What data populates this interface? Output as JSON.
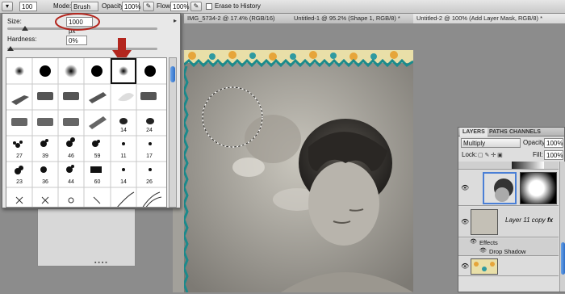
{
  "options_bar": {
    "brush_size": "100",
    "mode_label": "Mode:",
    "mode_value": "Brush",
    "opacity_label": "Opacity:",
    "opacity_value": "100%",
    "flow_label": "Flow:",
    "flow_value": "100%",
    "erase_history_label": "Erase to History"
  },
  "tabs": [
    {
      "label": "IMG_5734-2 @ 17.4% (RGB/16)"
    },
    {
      "label": "Untitled-1 @ 95.2% (Shape 1, RGB/8) *"
    },
    {
      "label": "Untitled-2 @ 100% (Add Layer Mask, RGB/8) *"
    }
  ],
  "brush_panel": {
    "size_label": "Size:",
    "size_value": "1000 px",
    "hardness_label": "Hardness:",
    "hardness_value": "0%",
    "rows": [
      [
        "",
        "",
        "",
        "",
        "",
        ""
      ],
      [
        "",
        "",
        "",
        "",
        "",
        ""
      ],
      [
        "",
        "",
        "",
        "",
        "14",
        "24"
      ],
      [
        "27",
        "39",
        "46",
        "59",
        "11",
        "17"
      ],
      [
        "23",
        "36",
        "44",
        "60",
        "14",
        "26"
      ],
      [
        "",
        "",
        "",
        "",
        "",
        ""
      ]
    ]
  },
  "layers_panel": {
    "tabs": [
      "LAYERS",
      "PATHS",
      "CHANNELS"
    ],
    "blend_mode": "Multiply",
    "opacity_label": "Opacity:",
    "opacity_value": "100%",
    "lock_label": "Lock:",
    "fill_label": "Fill:",
    "fill_value": "100%",
    "layer_name": "Layer 11 copy",
    "effects_label": "Effects",
    "drop_shadow_label": "Drop Shadow"
  },
  "colors": {
    "annotation_red": "#b3261e",
    "teal_trim": "#1b8a8c"
  }
}
